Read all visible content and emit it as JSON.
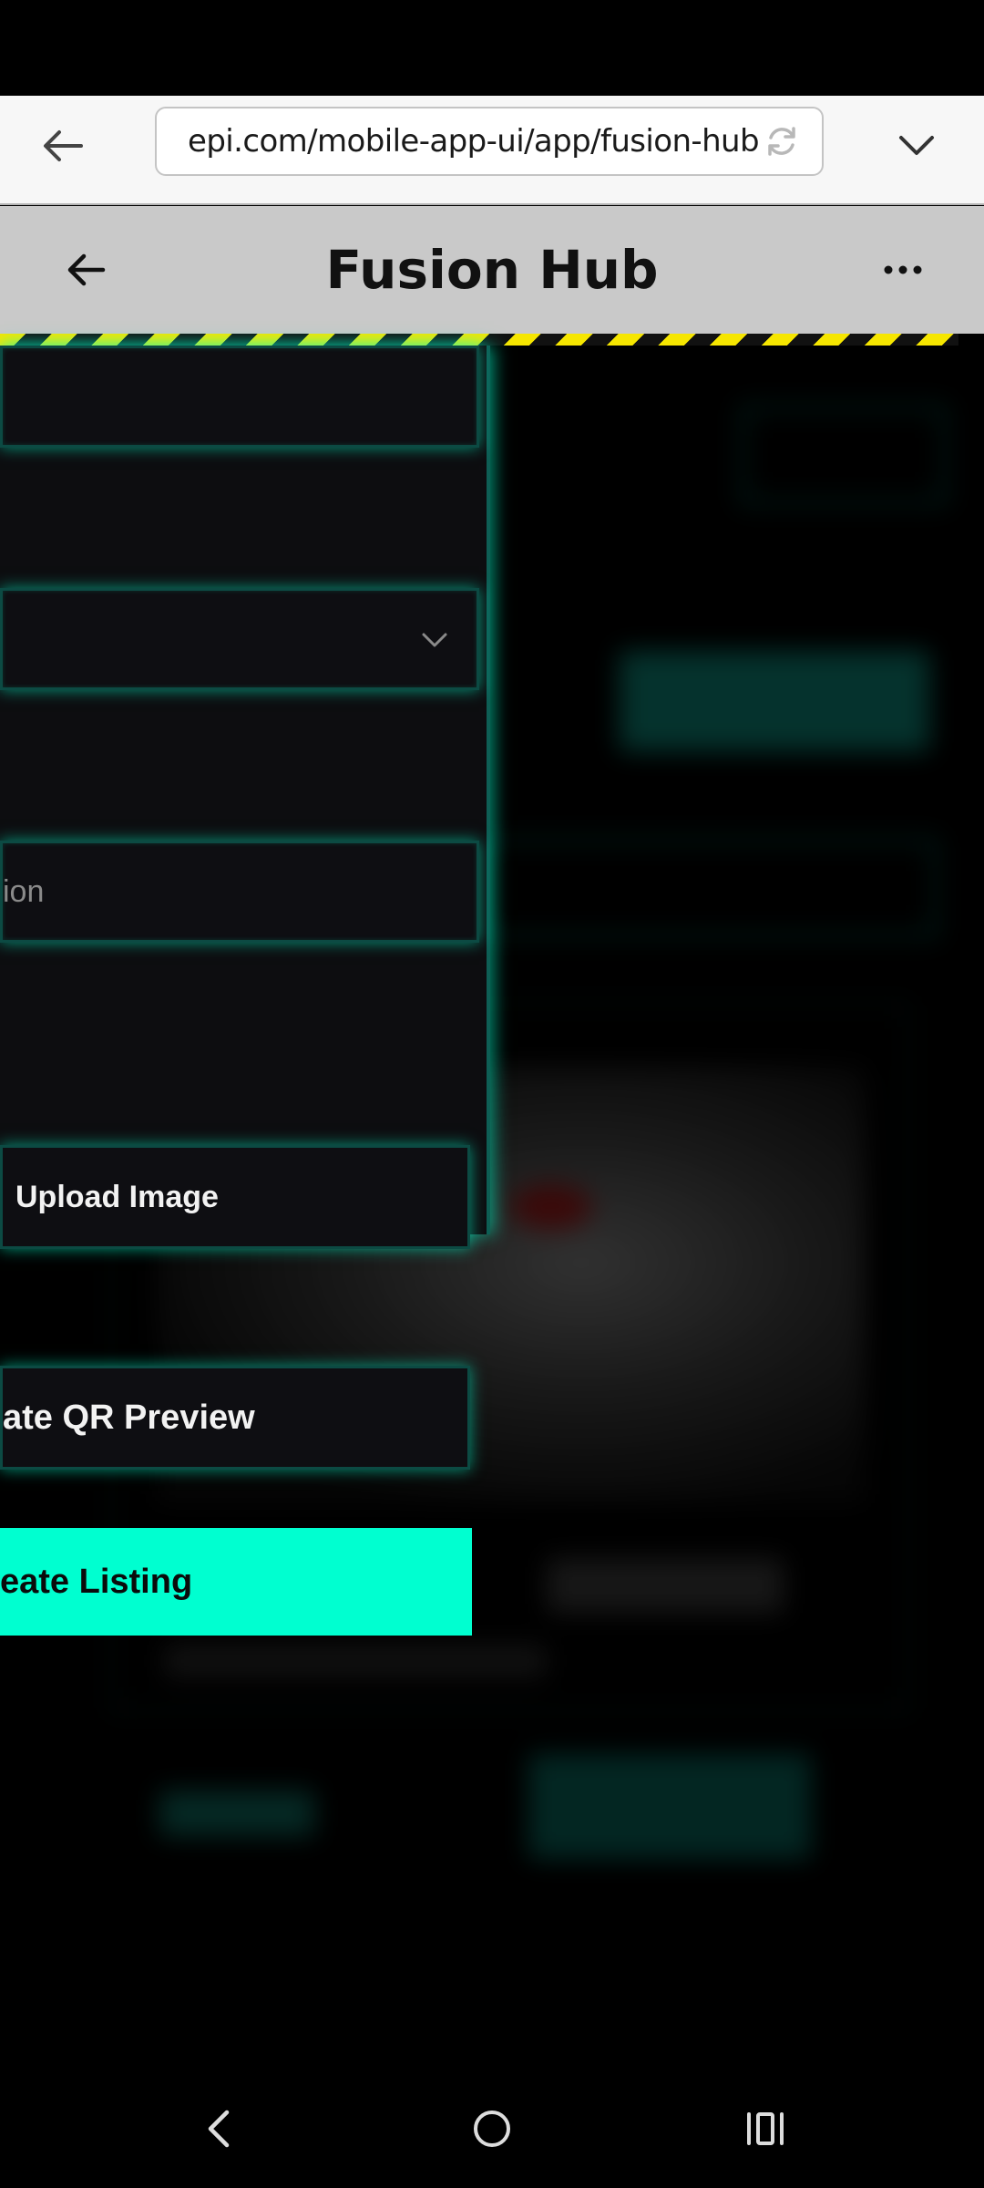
{
  "browser": {
    "url": "epi.com/mobile-app-ui/app/fusion-hub",
    "back_icon": "arrow-left-icon",
    "reload_icon": "reload-icon",
    "menu_icon": "chevron-down-icon"
  },
  "app_header": {
    "title": "Fusion Hub",
    "back_icon": "arrow-left-icon",
    "more_icon": "more-horizontal-icon"
  },
  "form_panel": {
    "description_placeholder": "ion",
    "dropdown_icon": "chevron-down-icon",
    "upload_button": "Upload Image",
    "qr_preview_button": "ate QR Preview",
    "create_listing_button": "eate Listing"
  },
  "nav_bar": {
    "back_icon": "nav-back-icon",
    "home_icon": "nav-home-icon",
    "recent_icon": "nav-recent-apps-icon"
  },
  "colors": {
    "accent": "#00ffd0",
    "panel_bg": "#0d0d10",
    "header_bg": "#c9c9c9",
    "hazard_yellow": "#f6e600"
  }
}
